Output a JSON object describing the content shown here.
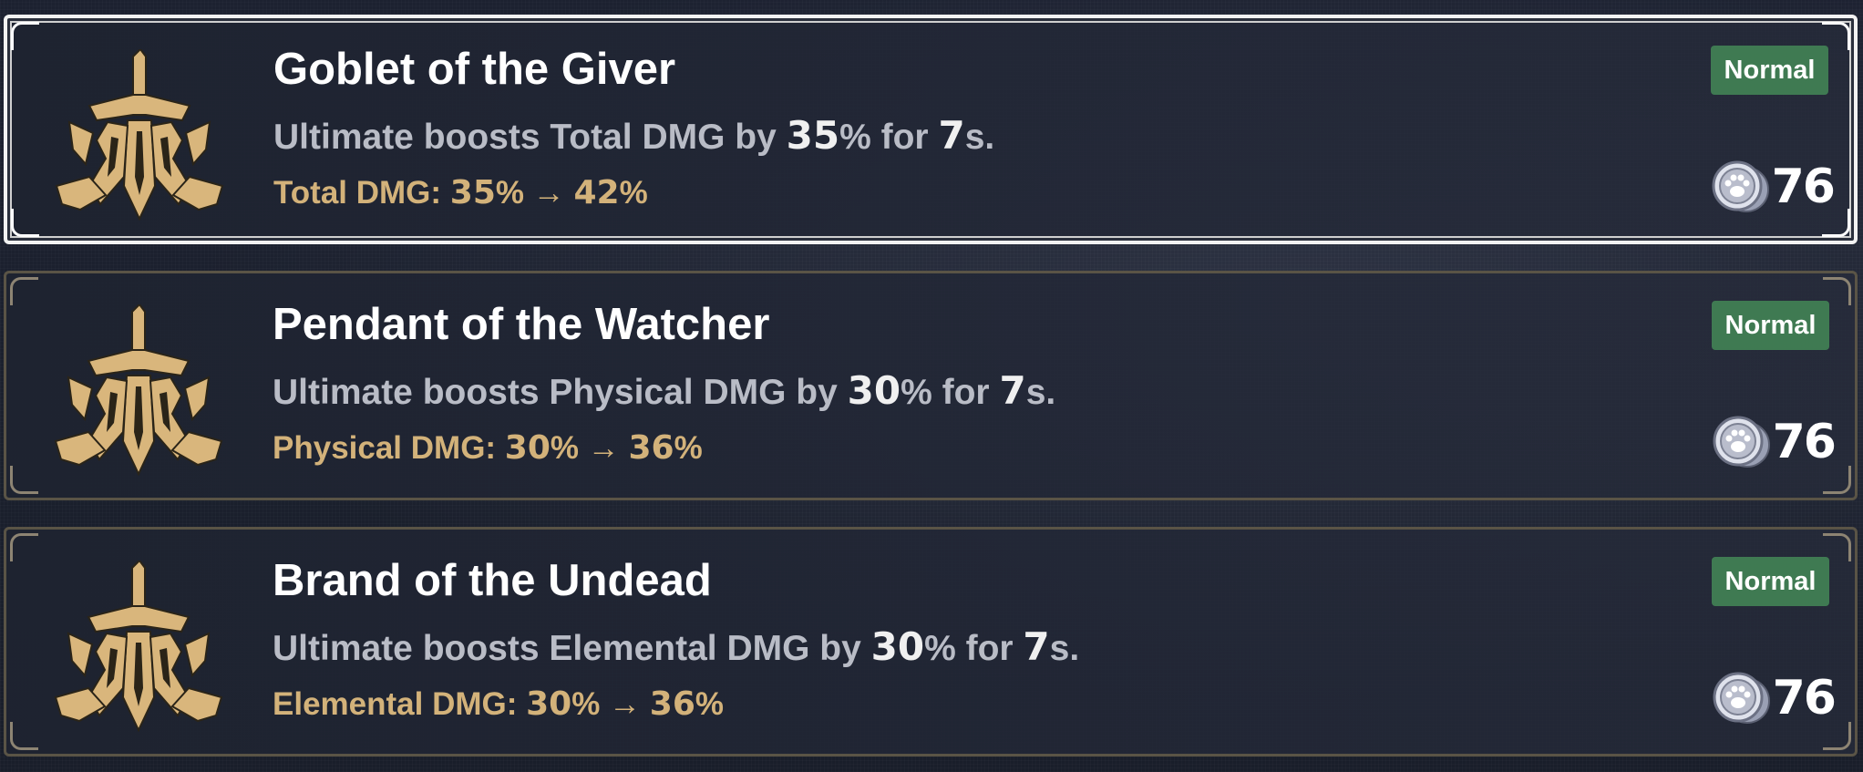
{
  "cards": [
    {
      "title": "Goblet of the Giver",
      "desc_prefix": "Ultimate boosts Total DMG by ",
      "desc_value": "35",
      "desc_mid": "% for ",
      "desc_duration": "7",
      "desc_suffix": "s.",
      "stat_label": "Total DMG: ",
      "stat_from": "35",
      "stat_arrow": "% → ",
      "stat_to": "42",
      "stat_unit": "%",
      "rarity": "Normal",
      "cost": "76",
      "selected": true
    },
    {
      "title": "Pendant of the Watcher",
      "desc_prefix": "Ultimate boosts Physical DMG by ",
      "desc_value": "30",
      "desc_mid": "% for ",
      "desc_duration": "7",
      "desc_suffix": "s.",
      "stat_label": "Physical DMG: ",
      "stat_from": "30",
      "stat_arrow": "% → ",
      "stat_to": "36",
      "stat_unit": "%",
      "rarity": "Normal",
      "cost": "76",
      "selected": false
    },
    {
      "title": "Brand of the Undead",
      "desc_prefix": "Ultimate boosts Elemental DMG by ",
      "desc_value": "30",
      "desc_mid": "% for ",
      "desc_duration": "7",
      "desc_suffix": "s.",
      "stat_label": "Elemental DMG: ",
      "stat_from": "30",
      "stat_arrow": "% → ",
      "stat_to": "36",
      "stat_unit": "%",
      "rarity": "Normal",
      "cost": "76",
      "selected": false
    }
  ],
  "colors": {
    "title": "#ffffff",
    "description": "#b9bcc6",
    "stat": "#d3b27a",
    "badge": "#3f7a52",
    "emblem": "#d9b67c"
  },
  "icons": {
    "emblem": "sword-crest-emblem-icon",
    "currency": "paw-coin-icon"
  }
}
